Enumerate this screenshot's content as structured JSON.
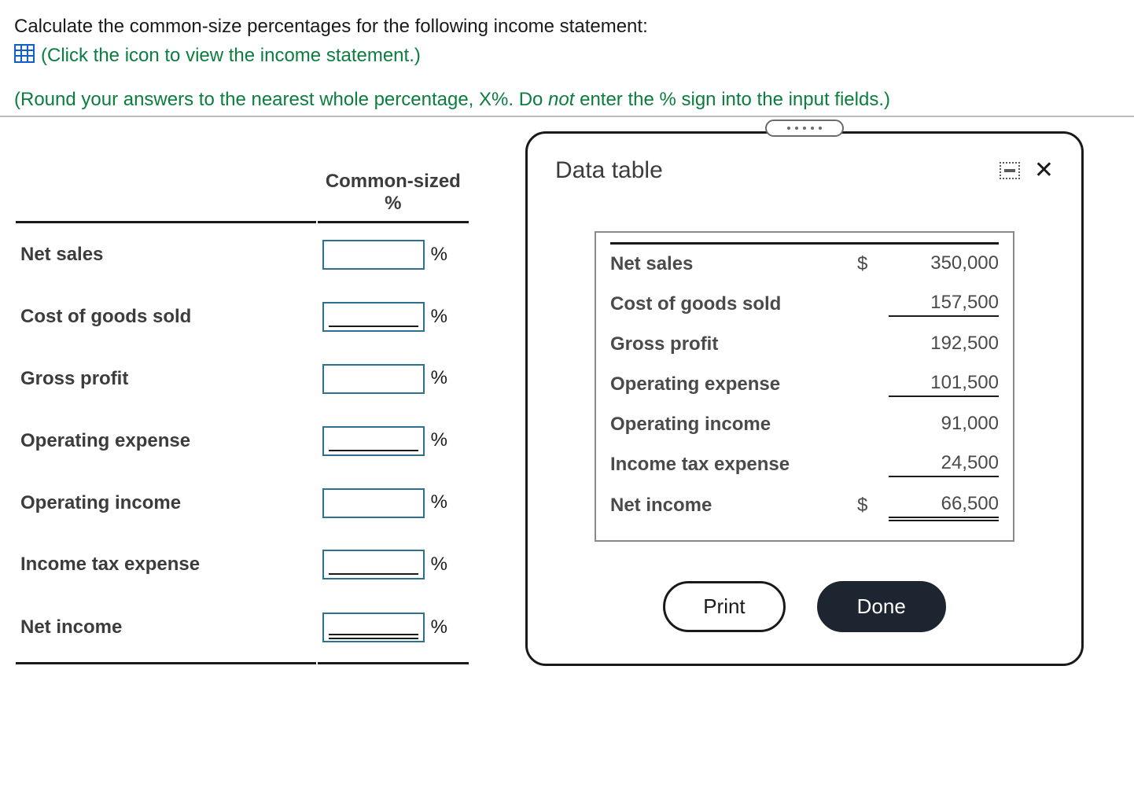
{
  "question": "Calculate the common-size percentages for the following income statement:",
  "hint": "(Click the icon to view the income statement.)",
  "instruction_pre": "(Round your answers to the nearest whole percentage, X%. Do ",
  "instruction_em": "not",
  "instruction_post": " enter the % sign into the input fields.)",
  "common_size_header": "Common-sized %",
  "percent_sign": "%",
  "rows": {
    "net_sales": "Net sales",
    "cogs": "Cost of goods sold",
    "gross_profit": "Gross profit",
    "operating_expense": "Operating expense",
    "operating_income": "Operating income",
    "income_tax_expense": "Income tax expense",
    "net_income": "Net income"
  },
  "popup": {
    "title": "Data table",
    "currency": "$",
    "items": {
      "net_sales": {
        "label": "Net sales",
        "value": "350,000"
      },
      "cogs": {
        "label": "Cost of goods sold",
        "value": "157,500"
      },
      "gross_profit": {
        "label": "Gross profit",
        "value": "192,500"
      },
      "operating_expense": {
        "label": "Operating expense",
        "value": "101,500"
      },
      "operating_income": {
        "label": "Operating income",
        "value": "91,000"
      },
      "income_tax_expense": {
        "label": "Income tax expense",
        "value": "24,500"
      },
      "net_income": {
        "label": "Net income",
        "value": "66,500"
      }
    },
    "print": "Print",
    "done": "Done"
  },
  "chart_data": {
    "type": "table",
    "title": "Income Statement",
    "rows": [
      {
        "label": "Net sales",
        "value": 350000
      },
      {
        "label": "Cost of goods sold",
        "value": 157500
      },
      {
        "label": "Gross profit",
        "value": 192500
      },
      {
        "label": "Operating expense",
        "value": 101500
      },
      {
        "label": "Operating income",
        "value": 91000
      },
      {
        "label": "Income tax expense",
        "value": 24500
      },
      {
        "label": "Net income",
        "value": 66500
      }
    ]
  }
}
